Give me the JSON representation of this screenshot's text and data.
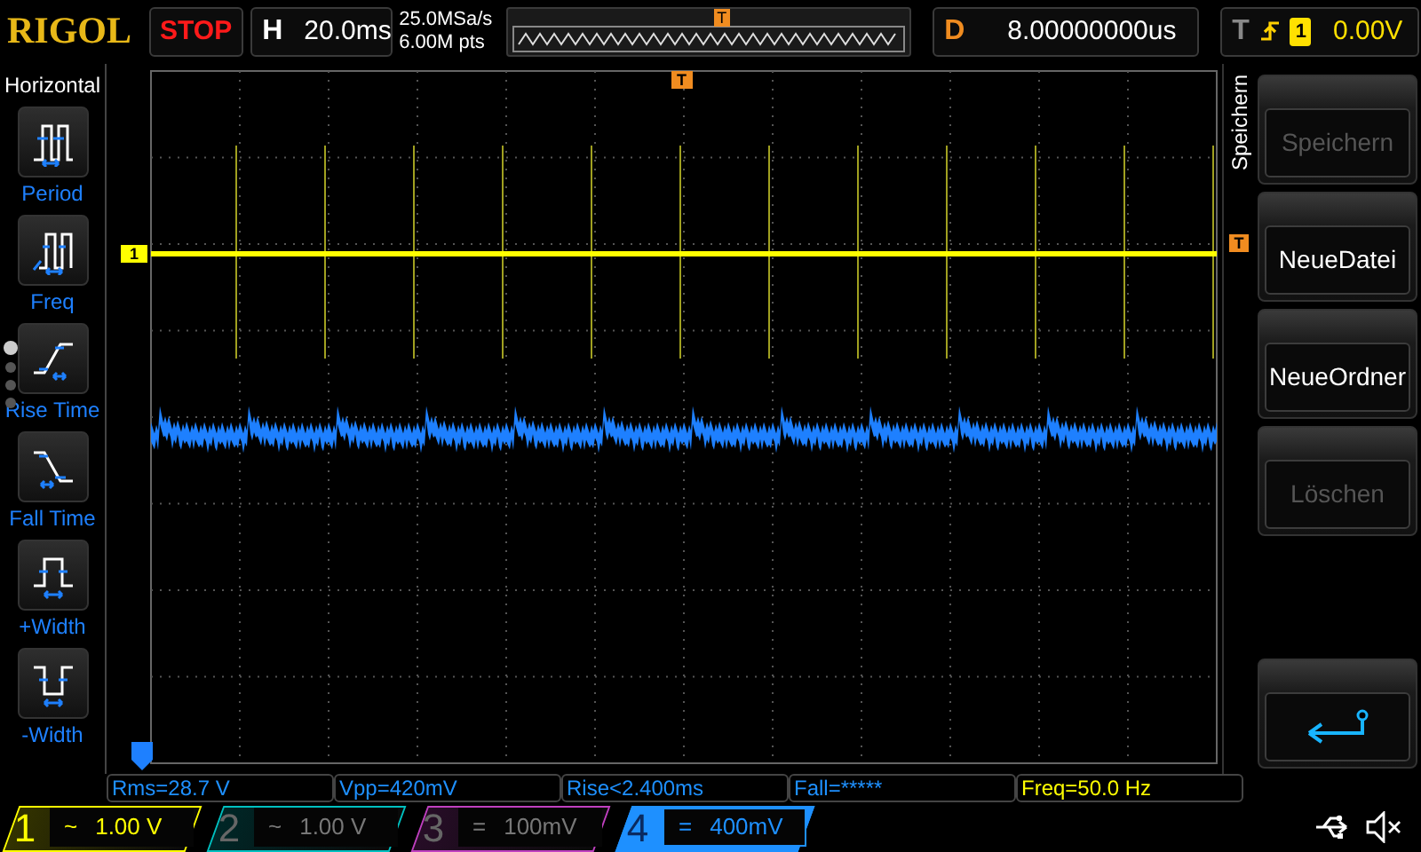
{
  "header": {
    "brand": "RIGOL",
    "run_state": "STOP",
    "horizontal": {
      "label": "H",
      "value": "20.0ms"
    },
    "sample_rate": "25.0MSa/s",
    "memory_depth": "6.00M pts",
    "overview_marker": "T",
    "delay": {
      "label": "D",
      "value": "8.00000000us"
    },
    "trigger": {
      "label": "T",
      "source": "1",
      "level": "0.00V"
    }
  },
  "measure_menu": {
    "title": "Horizontal",
    "items": [
      {
        "kind": "period",
        "label": "Period"
      },
      {
        "kind": "freq",
        "label": "Freq"
      },
      {
        "kind": "rise",
        "label": "Rise Time"
      },
      {
        "kind": "fall",
        "label": "Fall Time"
      },
      {
        "kind": "pwidth",
        "label": "+Width"
      },
      {
        "kind": "nwidth",
        "label": "-Width"
      }
    ],
    "page_dots": [
      {
        "selected": true
      },
      {
        "selected": false
      },
      {
        "selected": false
      },
      {
        "selected": false
      }
    ]
  },
  "plot": {
    "trigger_marker": "T",
    "channel_marker": "1",
    "trigger_level_marker": "T"
  },
  "measurements": [
    {
      "text": "Rms=28.7 V",
      "color": "#1e90ff"
    },
    {
      "text": "Vpp=420mV",
      "color": "#1e90ff"
    },
    {
      "text": "Rise<2.400ms",
      "color": "#1e90ff"
    },
    {
      "text": "Fall=*****",
      "color": "#1e90ff"
    },
    {
      "text": "Freq=50.0 Hz",
      "color": "#ffff00"
    }
  ],
  "channels": [
    {
      "number": "1",
      "coupling": "~",
      "scale": "1.00 V",
      "on": true,
      "selected": false,
      "color": "#ffff00"
    },
    {
      "number": "2",
      "coupling": "~",
      "scale": "1.00 V",
      "on": false,
      "selected": false,
      "color": "#00c0c0"
    },
    {
      "number": "3",
      "coupling": "=",
      "scale": "100mV",
      "on": false,
      "selected": false,
      "color": "#c040c0"
    },
    {
      "number": "4",
      "coupling": "=",
      "scale": "400mV",
      "on": true,
      "selected": true,
      "color": "#1e90ff"
    }
  ],
  "side_menu": {
    "title": "Speichern",
    "buttons": [
      {
        "kind": "text",
        "label": "Speichern",
        "disabled": true
      },
      {
        "kind": "text",
        "label": "NeueDatei",
        "disabled": false
      },
      {
        "kind": "text",
        "label": "NeueOrdner",
        "disabled": false
      },
      {
        "kind": "text",
        "label": "Löschen",
        "disabled": true
      },
      {
        "kind": "back",
        "disabled": false
      }
    ]
  }
}
